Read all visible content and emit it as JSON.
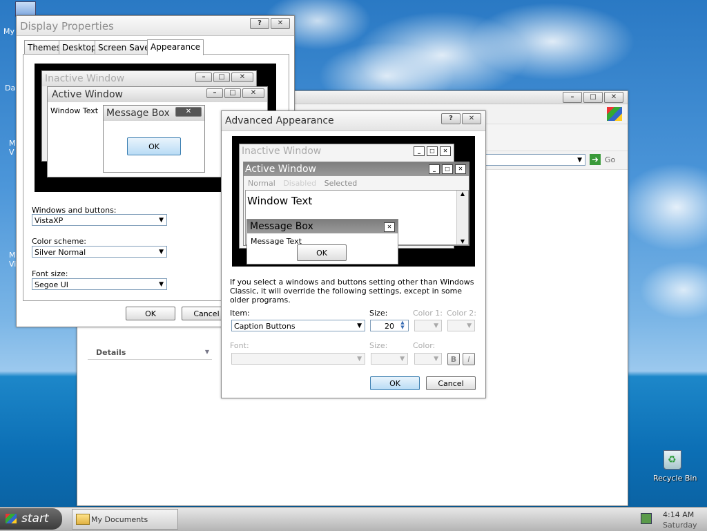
{
  "desktop": {
    "icons_left": [
      "My",
      "Da",
      "M\nV",
      "M\nVi"
    ],
    "recycle_bin": "Recycle Bin"
  },
  "taskbar": {
    "start": "start",
    "task": "My Documents",
    "time": "4:14 AM",
    "day": "Saturday"
  },
  "explorer": {
    "go": "Go",
    "details": "Details"
  },
  "display_properties": {
    "title": "Display Properties",
    "tabs": [
      "Themes",
      "Desktop",
      "Screen Saver",
      "Appearance"
    ],
    "preview": {
      "inactive": "Inactive Window",
      "active": "Active Window",
      "window_text": "Window Text",
      "message_box": "Message Box",
      "ok": "OK"
    },
    "windows_buttons_label": "Windows and buttons:",
    "windows_buttons_value": "VistaXP",
    "color_scheme_label": "Color scheme:",
    "color_scheme_value": "Silver Normal",
    "font_size_label": "Font size:",
    "font_size_value": "Segoe UI",
    "ok": "OK",
    "cancel": "Cancel"
  },
  "advanced": {
    "title": "Advanced Appearance",
    "preview": {
      "inactive": "Inactive Window",
      "active": "Active Window",
      "normal": "Normal",
      "disabled": "Disabled",
      "selected": "Selected",
      "window_text": "Window Text",
      "message_box": "Message Box",
      "message_text": "Message Text",
      "ok": "OK"
    },
    "info": "If you select a windows and buttons setting other than Windows Classic, it will override the following settings, except in some older programs.",
    "item_label": "Item:",
    "item_value": "Caption Buttons",
    "size_label": "Size:",
    "size_value": "20",
    "color1_label": "Color 1:",
    "color2_label": "Color 2:",
    "font_label": "Font:",
    "font_size_label": "Size:",
    "font_color_label": "Color:",
    "bold": "B",
    "italic": "I",
    "ok": "OK",
    "cancel": "Cancel"
  }
}
